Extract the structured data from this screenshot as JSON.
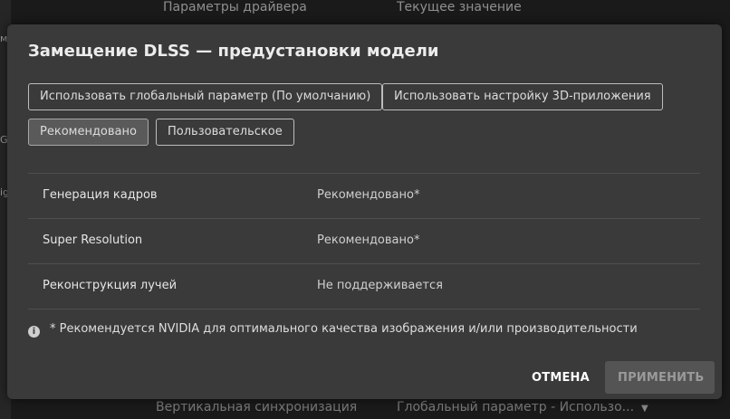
{
  "background": {
    "header": {
      "col1": "Параметры драйвера",
      "col2": "Текущее значение"
    },
    "left_fragments": [
      "м",
      "G",
      "ig"
    ],
    "bottom_row": {
      "name": "Вертикальная синхронизация",
      "value": "Глобальный параметр - Использо..."
    }
  },
  "dialog": {
    "title": "Замещение DLSS — предустановки модели",
    "options": [
      {
        "label": "Использовать глобальный параметр (По умолчанию)",
        "selected": false
      },
      {
        "label": "Использовать настройку 3D-приложения",
        "selected": false
      },
      {
        "label": "Рекомендовано",
        "selected": true
      },
      {
        "label": "Пользовательское",
        "selected": false
      }
    ],
    "rows": [
      {
        "name": "Генерация кадров",
        "value": "Рекомендовано*"
      },
      {
        "name": "Super Resolution",
        "value": "Рекомендовано*"
      },
      {
        "name": "Реконструкция лучей",
        "value": "Не поддерживается"
      }
    ],
    "note": "* Рекомендуется NVIDIA для оптимального качества изображения и/или производительности",
    "buttons": {
      "cancel": "ОТМЕНА",
      "apply": "ПРИМЕНИТЬ"
    }
  }
}
